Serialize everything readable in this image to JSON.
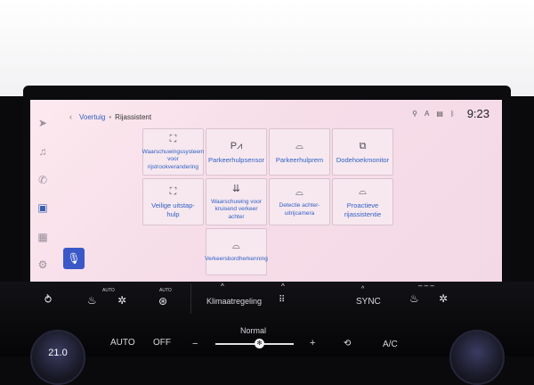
{
  "breadcrumb": {
    "parent": "Voertuig",
    "current": "Rijassistent"
  },
  "status": {
    "time": "9:23"
  },
  "tiles": [
    {
      "label": "Waarschuwingssysteem voor rijstrookverandering",
      "icon": "lane-change-icon"
    },
    {
      "label": "Parkeerhulpsensor",
      "icon": "parking-sensor-icon"
    },
    {
      "label": "Parkeerhulprem",
      "icon": "parking-brake-assist-icon"
    },
    {
      "label": "Dodehoekmonitor",
      "icon": "blind-spot-icon"
    },
    {
      "label": "Veilige uitstap- hulp",
      "icon": "safe-exit-icon"
    },
    {
      "label": "Waarschuwing voor kruisend verkeer achter",
      "icon": "rear-cross-traffic-icon"
    },
    {
      "label": "Detectie achter-uitrijcamera",
      "icon": "rear-camera-detection-icon"
    },
    {
      "label": "Proactieve rijassistentie",
      "icon": "proactive-assist-icon"
    },
    {
      "label": "Verkeersbordherkenning",
      "icon": "traffic-sign-icon"
    }
  ],
  "climate": {
    "auto_badge_1": "AUTO",
    "auto_badge_2": "AUTO",
    "climate_label": "Klimaatregeling",
    "sync_label": "SYNC",
    "auto_label": "AUTO",
    "off_label": "OFF",
    "fan_mode": "Normal",
    "minus": "−",
    "plus": "+",
    "ac_label": "A/C",
    "temp_left": "21.0"
  }
}
